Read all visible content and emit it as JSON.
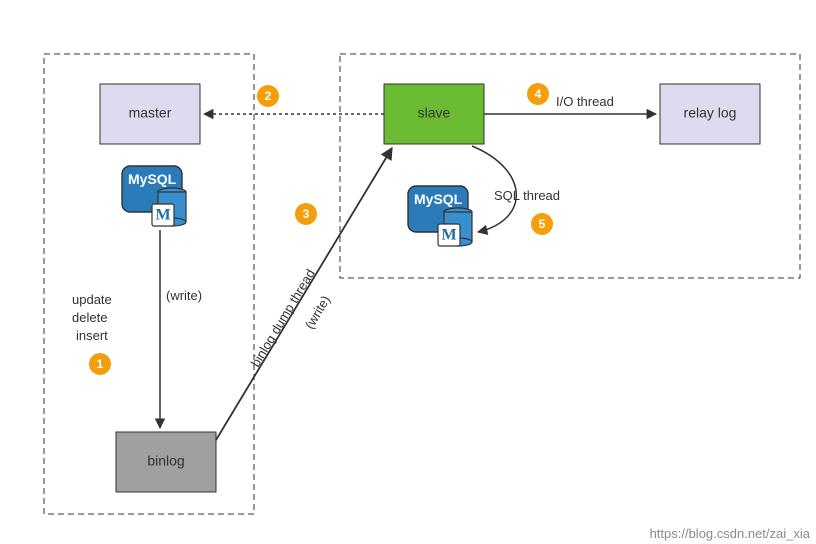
{
  "boxes": {
    "master": "master",
    "slave": "slave",
    "binlog": "binlog",
    "relay_log": "relay log"
  },
  "mysql_logo_text": "MySQL",
  "mysql_logo_letter": "M",
  "steps": {
    "s1": "1",
    "s2": "2",
    "s3": "3",
    "s4": "4",
    "s5": "5"
  },
  "labels": {
    "write1": "(write)",
    "write2": "(write)",
    "ops_update": "update",
    "ops_delete": "delete",
    "ops_insert": "insert",
    "binlog_dump_thread": "binlog dump thread",
    "io_thread": "I/O thread",
    "sql_thread": "SQL thread"
  },
  "watermark": "https://blog.csdn.net/zai_xia"
}
